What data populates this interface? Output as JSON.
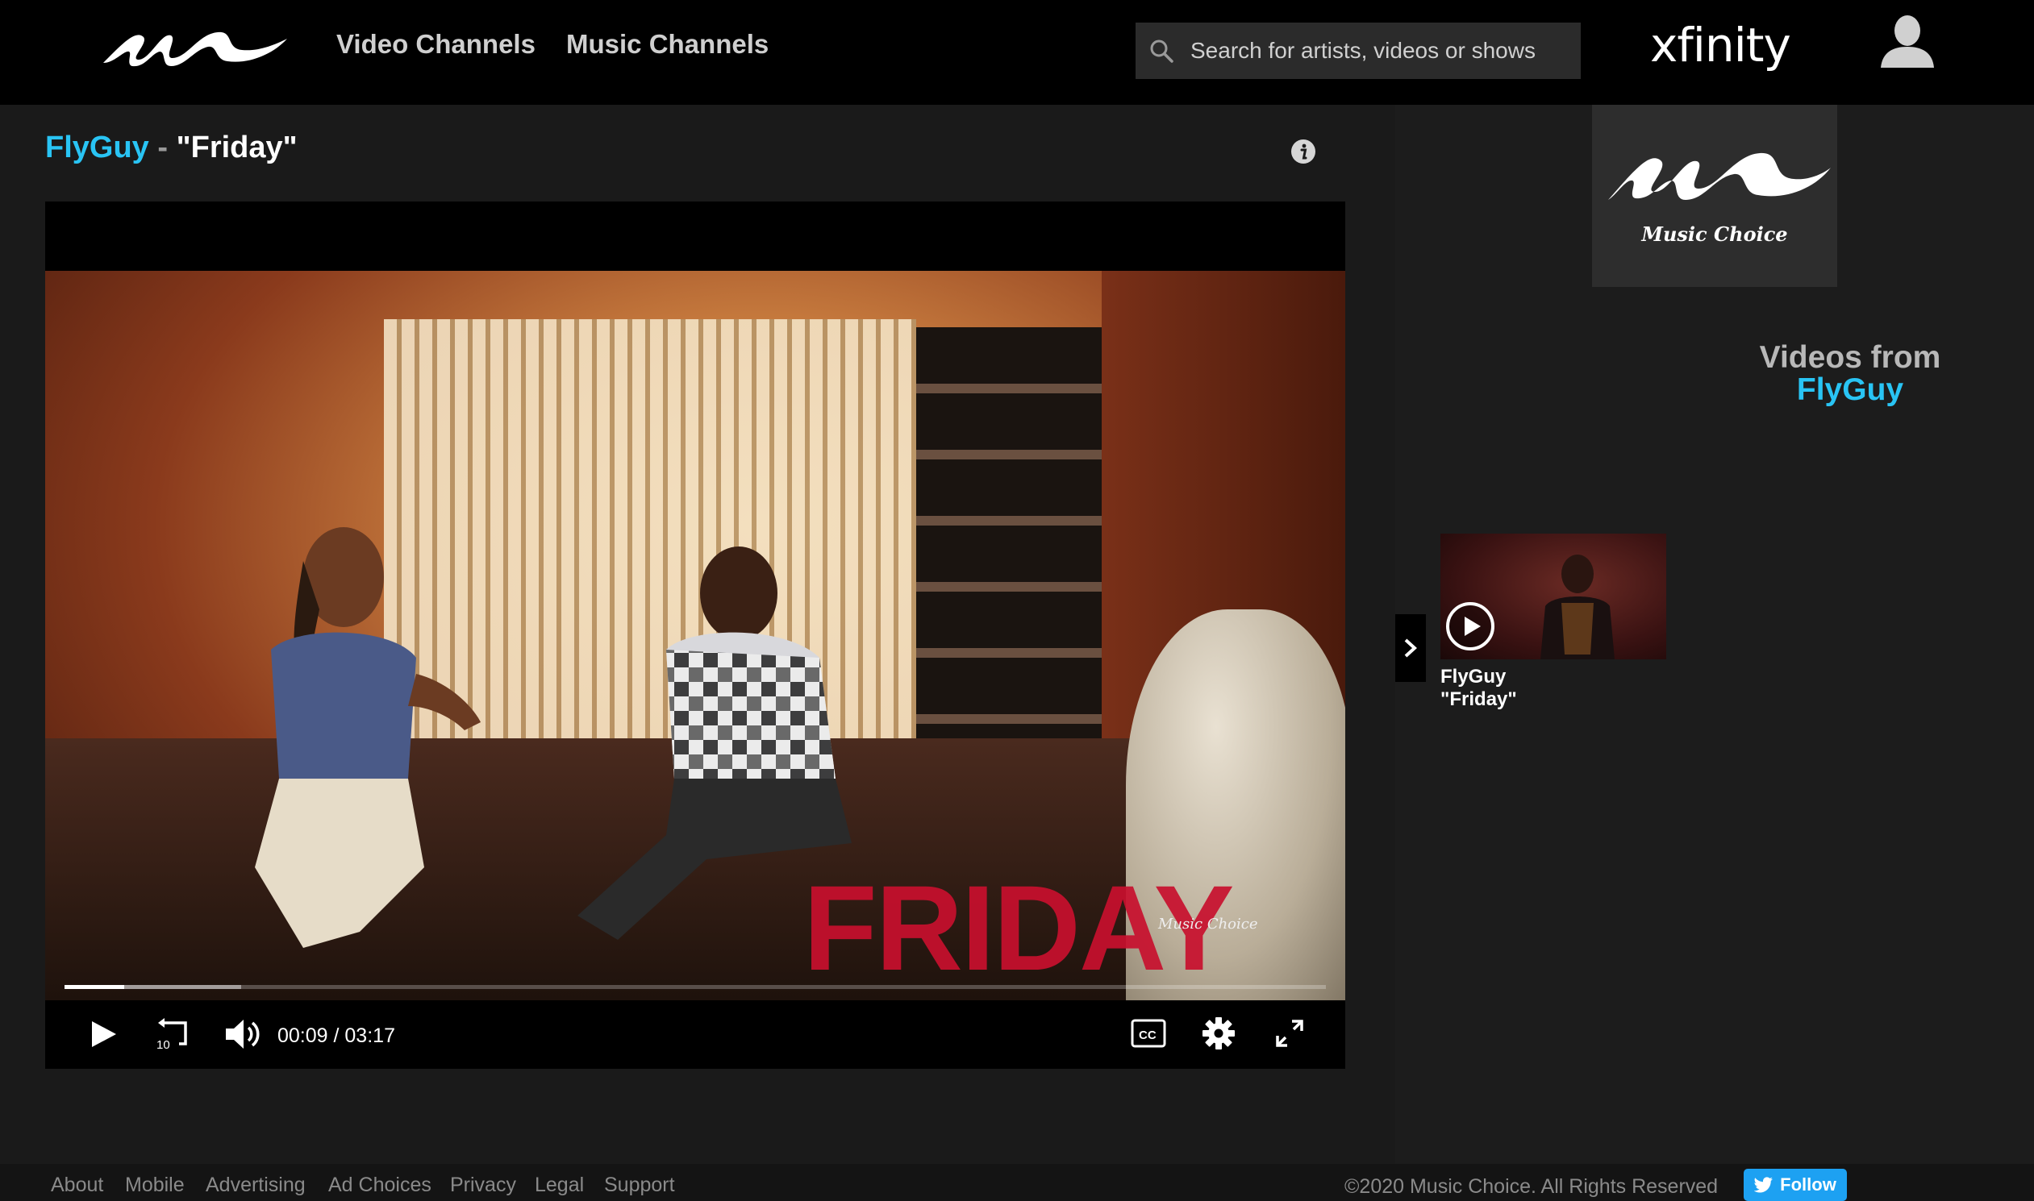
{
  "header": {
    "nav": [
      {
        "label": "Video Channels"
      },
      {
        "label": "Music Channels"
      }
    ],
    "search": {
      "placeholder": "Search for artists, videos or shows"
    },
    "brand": "xfinity"
  },
  "video": {
    "artist": "FlyGuy",
    "separator": " - ",
    "song": "\"Friday\"",
    "overlay_text": "FRIDAY",
    "watermark": "Music Choice",
    "current_time": "00:09",
    "time_separator": " / ",
    "duration": "03:17",
    "progress_fraction": 0.047,
    "buffered_fraction": 0.14
  },
  "sidebar": {
    "logo_text": "Music Choice",
    "heading": "Videos from",
    "heading_artist": "FlyGuy",
    "items": [
      {
        "artist": "FlyGuy",
        "title": "\"Friday\""
      }
    ]
  },
  "footer": {
    "links": [
      "About",
      "Mobile",
      "Advertising",
      "Ad Choices",
      "Privacy",
      "Legal",
      "Support"
    ],
    "copyright": "©2020 Music Choice. All Rights Reserved",
    "follow_label": "Follow"
  },
  "colors": {
    "accent": "#29c4f4",
    "twitter": "#1da1f2",
    "friday_red": "#c8102e"
  }
}
